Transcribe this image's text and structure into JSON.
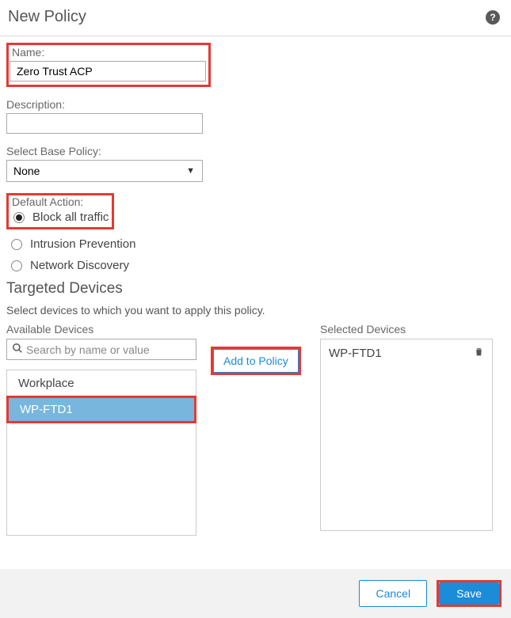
{
  "header": {
    "title": "New Policy"
  },
  "name": {
    "label": "Name:",
    "value": "Zero Trust ACP"
  },
  "description": {
    "label": "Description:",
    "value": ""
  },
  "basePolicy": {
    "label": "Select Base Policy:",
    "value": "None"
  },
  "defaultAction": {
    "label": "Default Action:",
    "options": {
      "block": "Block all traffic",
      "intrusion": "Intrusion Prevention",
      "discovery": "Network Discovery"
    }
  },
  "targeted": {
    "title": "Targeted Devices",
    "instruction": "Select devices to which you want to apply this policy."
  },
  "available": {
    "label": "Available Devices",
    "searchPlaceholder": "Search by name or value",
    "parent": "Workplace",
    "items": {
      "wpftd1": "WP-FTD1"
    }
  },
  "addButton": "Add to Policy",
  "selected": {
    "label": "Selected Devices",
    "items": {
      "wpftd1": "WP-FTD1"
    }
  },
  "footer": {
    "cancel": "Cancel",
    "save": "Save"
  }
}
